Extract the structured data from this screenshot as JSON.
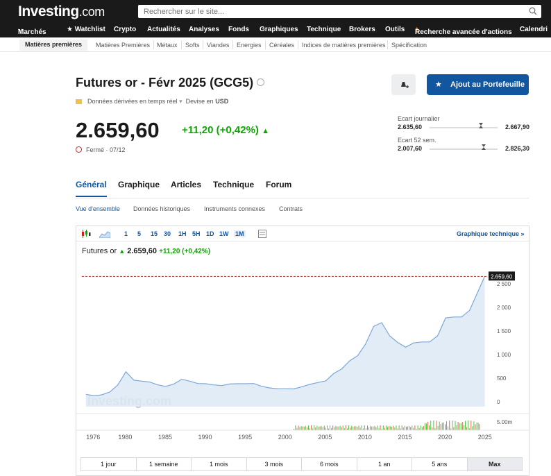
{
  "header": {
    "logo": "Investing",
    "logo_suffix": ".com",
    "search_placeholder": "Rechercher sur le site..."
  },
  "nav": [
    "Marchés",
    "★ Watchlist",
    "Crypto",
    "Actualités",
    "Analyses",
    "Fonds",
    "Graphiques",
    "Technique",
    "Brokers",
    "Outils",
    "Recherche avancée d'actions",
    "Calendri"
  ],
  "subnav": [
    "Matières premières",
    "Matières Premières",
    "Métaux",
    "Softs",
    "Viandes",
    "Energies",
    "Céréales",
    "Indices de matières premières",
    "Spécification"
  ],
  "instrument": {
    "title": "Futures or - Févr 2025 (GCG5)",
    "realtime": "Données dérivées en temps réel",
    "currency_label": "Devise en",
    "currency": "USD",
    "price": "2.659,60",
    "change": "+11,20 (+0,42%)",
    "status": "Fermé · 07/12",
    "portfolio_button": "Ajout au Portefeuille"
  },
  "ranges": {
    "daily": {
      "label": "Ecart journalier",
      "low": "2.635,60",
      "high": "2.667,90",
      "position": 0.75
    },
    "week52": {
      "label": "Ecart 52 sem.",
      "low": "2.007,60",
      "high": "2.826,30",
      "position": 0.8
    }
  },
  "tabs": [
    "Général",
    "Graphique",
    "Articles",
    "Technique",
    "Forum"
  ],
  "subtabs": [
    "Vue d'ensemble",
    "Données historiques",
    "Instruments connexes",
    "Contrats"
  ],
  "chart_toolbar": {
    "intervals": [
      "1",
      "5",
      "15",
      "30",
      "1H",
      "5H",
      "1D",
      "1W",
      "1M"
    ],
    "technical_link": "Graphique technique »"
  },
  "chart_legend": {
    "name": "Futures or",
    "price": "2.659,60",
    "change": "+11,20 (+0,42%)"
  },
  "colors": {
    "accent": "#1256a0",
    "up": "#0ea600",
    "down": "#d91e18",
    "area": "#dce9f5",
    "line": "#7aa7d6"
  },
  "chart_data": {
    "type": "area",
    "x": [
      1975,
      1976,
      1977,
      1978,
      1979,
      1980,
      1981,
      1982,
      1983,
      1984,
      1985,
      1986,
      1987,
      1988,
      1989,
      1990,
      1991,
      1992,
      1993,
      1994,
      1995,
      1996,
      1997,
      1998,
      1999,
      2000,
      2001,
      2002,
      2003,
      2004,
      2005,
      2006,
      2007,
      2008,
      2009,
      2010,
      2011,
      2012,
      2013,
      2014,
      2015,
      2016,
      2017,
      2018,
      2019,
      2020,
      2021,
      2022,
      2023,
      2024,
      2024.9
    ],
    "y": [
      160,
      130,
      150,
      210,
      360,
      640,
      460,
      440,
      420,
      360,
      330,
      380,
      480,
      440,
      390,
      385,
      360,
      345,
      380,
      385,
      385,
      390,
      330,
      295,
      280,
      280,
      275,
      320,
      370,
      410,
      445,
      600,
      700,
      870,
      980,
      1230,
      1600,
      1680,
      1400,
      1260,
      1160,
      1250,
      1270,
      1270,
      1400,
      1780,
      1800,
      1800,
      1940,
      2320,
      2659.6
    ],
    "y_ticks": [
      "2 500",
      "2 000",
      "1 500",
      "1 000",
      "500",
      "0"
    ],
    "y_tick_values": [
      2500,
      2000,
      1500,
      1000,
      500,
      0
    ],
    "x_tick_labels": [
      "1976",
      "1980",
      "1985",
      "1990",
      "1995",
      "2000",
      "2005",
      "2010",
      "2015",
      "2020",
      "2025"
    ],
    "x_tick_values": [
      1976,
      1980,
      1985,
      1990,
      1995,
      2000,
      2005,
      2010,
      2015,
      2020,
      2025
    ],
    "ylim": [
      -100,
      2900
    ],
    "last_price_label": "2.659,60",
    "volume_label": "5.00m",
    "watermark": "Investing.com"
  },
  "periods": [
    "1 jour",
    "1 semaine",
    "1 mois",
    "3 mois",
    "6 mois",
    "1 an",
    "5 ans",
    "Max"
  ]
}
